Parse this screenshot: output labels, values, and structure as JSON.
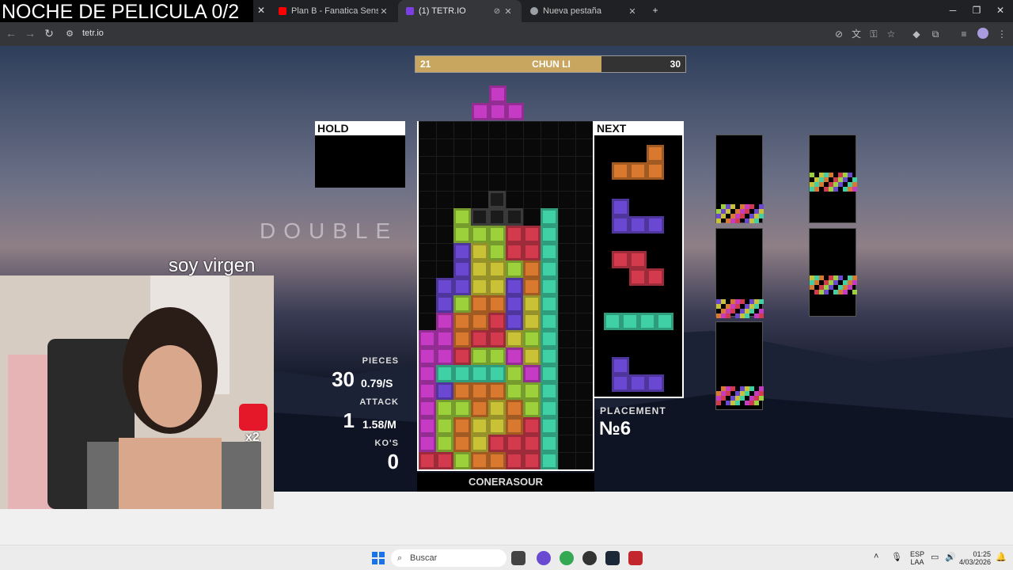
{
  "browser": {
    "tabs": [
      {
        "title": "Plan B - Fanatica Sensual ft. Nic",
        "fav_color": "#ff0000"
      },
      {
        "title": "(1) TETR.IO",
        "fav_color": "#7b3fe4"
      },
      {
        "title": "Nueva pestaña",
        "fav_color": "#9aa0a6"
      }
    ],
    "url": "tetr.io"
  },
  "stream_title": "NOCHE DE PELICULA 0/2",
  "game": {
    "vs_left_score": "21",
    "vs_name": "CHUN LI",
    "vs_right_score": "30",
    "vs_progress": 0.69,
    "hold_label": "HOLD",
    "next_label": "NEXT",
    "double_text": "DOUBLE",
    "pieces_label": "PIECES",
    "pieces_value": "30",
    "pieces_rate": "0.79/S",
    "attack_label": "ATTACK",
    "attack_value": "1",
    "attack_rate": "1.58/M",
    "kos_label": "KO'S",
    "kos_value": "0",
    "username": "CONERASOUR",
    "placement_label": "PLACEMENT",
    "placement_value": "№6"
  },
  "webcam": {
    "caption": "soy virgen",
    "badge": "x2"
  },
  "taskbar": {
    "search_placeholder": "Buscar",
    "lang_top": "ESP",
    "lang_bottom": "LAA",
    "time": "01:25",
    "date": "4/03/2026"
  },
  "colors": {
    "cyan": "#3fd1a5",
    "yellow": "#c9c236",
    "lime": "#9cd13c",
    "red": "#d33a4e",
    "orange": "#d9782f",
    "purple": "#6a48d1",
    "magenta": "#c53bc4",
    "accent": "#c9a660"
  }
}
